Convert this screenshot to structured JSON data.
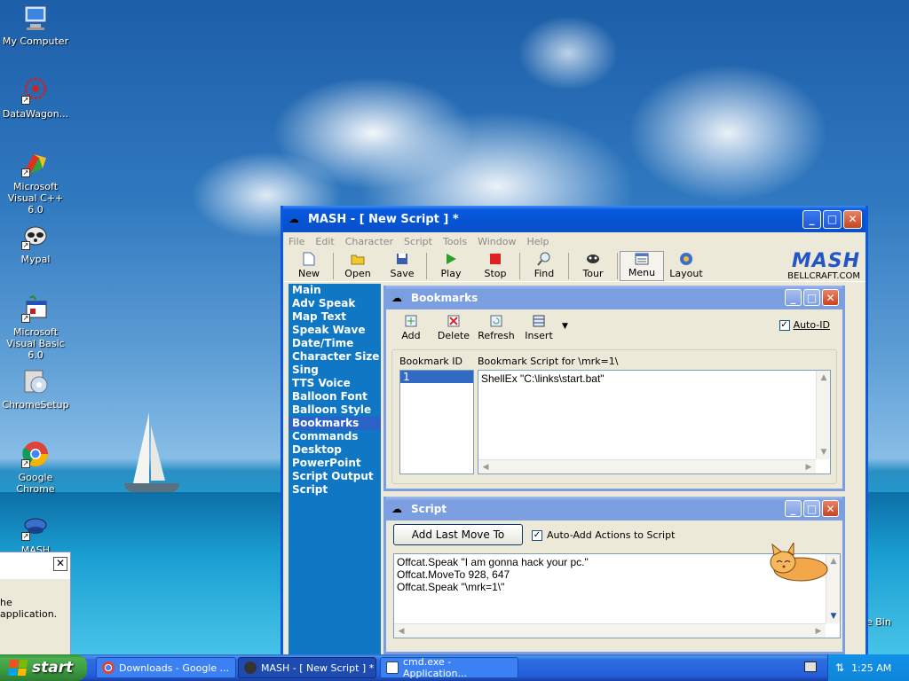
{
  "desktop": {
    "icons": [
      {
        "label": "My Computer"
      },
      {
        "label": "DataWagon..."
      },
      {
        "label": "Microsoft Visual C++ 6.0"
      },
      {
        "label": "Mypal"
      },
      {
        "label": "Microsoft Visual Basic 6.0"
      },
      {
        "label": "ChromeSetup"
      },
      {
        "label": "Google Chrome"
      },
      {
        "label": "MASH"
      }
    ],
    "partial_right_label": "e Bin"
  },
  "left_dialog": {
    "close_glyph": "✕",
    "message_fragment": "he application."
  },
  "mash_window": {
    "title": "MASH - [ New Script ] *",
    "menu": [
      "File",
      "Edit",
      "Character",
      "Script",
      "Tools",
      "Window",
      "Help"
    ],
    "toolbar": [
      {
        "label": "New",
        "icon": "new-file-icon"
      },
      {
        "label": "Open",
        "icon": "open-folder-icon"
      },
      {
        "label": "Save",
        "icon": "save-disk-icon"
      },
      {
        "label": "Play",
        "icon": "play-icon"
      },
      {
        "label": "Stop",
        "icon": "stop-icon"
      },
      {
        "label": "Find",
        "icon": "magnifier-icon"
      },
      {
        "label": "Tour",
        "icon": "tour-icon"
      },
      {
        "label": "Menu",
        "icon": "menu-icon"
      },
      {
        "label": "Layout",
        "icon": "layout-icon"
      }
    ],
    "logo": {
      "text": "MASH",
      "sub": "BELLCRAFT.COM"
    },
    "sidebar": [
      "Main",
      "Adv Speak",
      "Map Text",
      "Speak Wave",
      "Date/Time",
      "Character Size",
      "Sing",
      "TTS Voice",
      "Balloon Font",
      "Balloon Style",
      "Bookmarks",
      "Commands",
      "Desktop",
      "PowerPoint",
      "Script Output",
      "Script"
    ],
    "sidebar_selected": "Bookmarks"
  },
  "bookmarks": {
    "title": "Bookmarks",
    "toolbar": [
      "Add",
      "Delete",
      "Refresh",
      "Insert"
    ],
    "auto_id_label": "Auto-ID",
    "auto_id_checked": true,
    "col_id": "Bookmark ID",
    "col_script": "Bookmark Script for \\mrk=1\\",
    "selected_id": "1",
    "script_text": "ShellEx \"C:\\links\\start.bat\""
  },
  "script": {
    "title": "Script",
    "add_button": "Add Last Move To",
    "auto_add_label": "Auto-Add Actions to Script",
    "auto_add_checked": true,
    "lines": [
      "Offcat.Speak \"I am gonna hack your pc.\"",
      "Offcat.MoveTo 928, 647",
      "Offcat.Speak \"\\mrk=1\\\""
    ]
  },
  "taskbar": {
    "start_label": "start",
    "tasks": [
      {
        "label": "Downloads - Google ..."
      },
      {
        "label": "MASH - [ New Script ] *"
      },
      {
        "label": "cmd.exe - Application..."
      }
    ],
    "clock": "1:25 AM"
  },
  "colors": {
    "xp_blue": "#0a5ae0",
    "sidebar_blue": "#1077c4",
    "start_green": "#3c9a3f"
  }
}
